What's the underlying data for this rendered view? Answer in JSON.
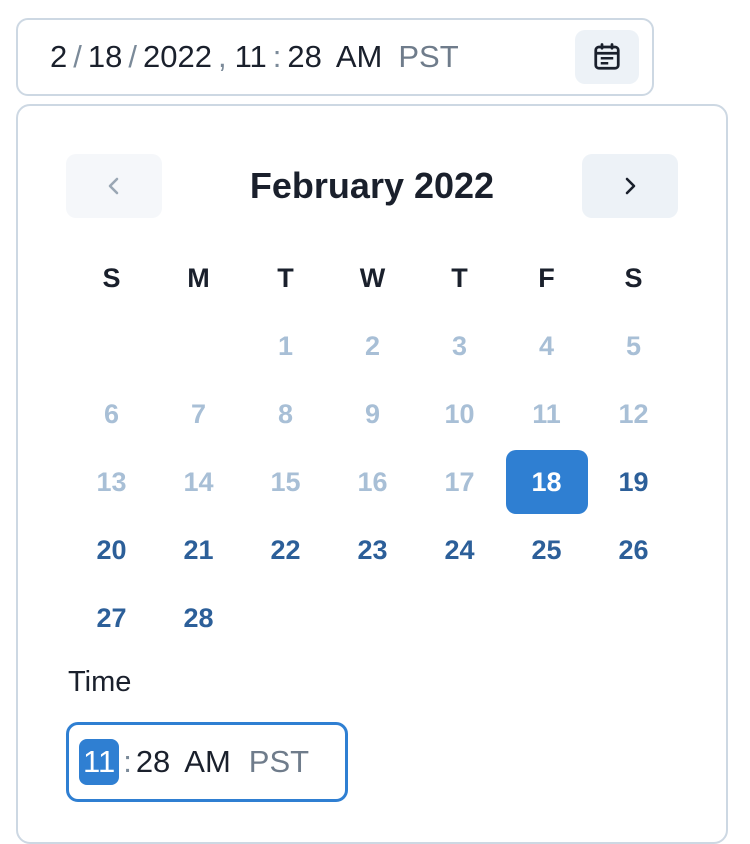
{
  "date_field": {
    "month": "2",
    "day": "18",
    "year": "2022",
    "hour": "11",
    "minute": "28",
    "ampm": "AM",
    "timezone": "PST",
    "date_sep": "/",
    "comma": ",",
    "time_sep": ":"
  },
  "calendar": {
    "title": "February 2022",
    "weekdays": [
      "S",
      "M",
      "T",
      "W",
      "T",
      "F",
      "S"
    ],
    "leading_blanks": 2,
    "days": [
      {
        "label": "1",
        "state": "disabled"
      },
      {
        "label": "2",
        "state": "disabled"
      },
      {
        "label": "3",
        "state": "disabled"
      },
      {
        "label": "4",
        "state": "disabled"
      },
      {
        "label": "5",
        "state": "disabled"
      },
      {
        "label": "6",
        "state": "disabled"
      },
      {
        "label": "7",
        "state": "disabled"
      },
      {
        "label": "8",
        "state": "disabled"
      },
      {
        "label": "9",
        "state": "disabled"
      },
      {
        "label": "10",
        "state": "disabled"
      },
      {
        "label": "11",
        "state": "disabled"
      },
      {
        "label": "12",
        "state": "disabled"
      },
      {
        "label": "13",
        "state": "disabled"
      },
      {
        "label": "14",
        "state": "disabled"
      },
      {
        "label": "15",
        "state": "disabled"
      },
      {
        "label": "16",
        "state": "disabled"
      },
      {
        "label": "17",
        "state": "disabled"
      },
      {
        "label": "18",
        "state": "selected"
      },
      {
        "label": "19",
        "state": "enabled"
      },
      {
        "label": "20",
        "state": "enabled"
      },
      {
        "label": "21",
        "state": "enabled"
      },
      {
        "label": "22",
        "state": "enabled"
      },
      {
        "label": "23",
        "state": "enabled"
      },
      {
        "label": "24",
        "state": "enabled"
      },
      {
        "label": "25",
        "state": "enabled"
      },
      {
        "label": "26",
        "state": "enabled"
      },
      {
        "label": "27",
        "state": "enabled"
      },
      {
        "label": "28",
        "state": "enabled"
      }
    ]
  },
  "time": {
    "label": "Time",
    "hour": "11",
    "minute": "28",
    "ampm": "AM",
    "timezone": "PST",
    "sep": ":"
  },
  "icons": {
    "calendar": "calendar-icon",
    "prev": "chevron-left-icon",
    "next": "chevron-right-icon"
  },
  "colors": {
    "accent": "#2f7fd2",
    "enabled_day": "#2c5f99",
    "disabled_day": "#a8bfd6",
    "border": "#cdd8e3",
    "button_bg": "#edf2f7"
  }
}
